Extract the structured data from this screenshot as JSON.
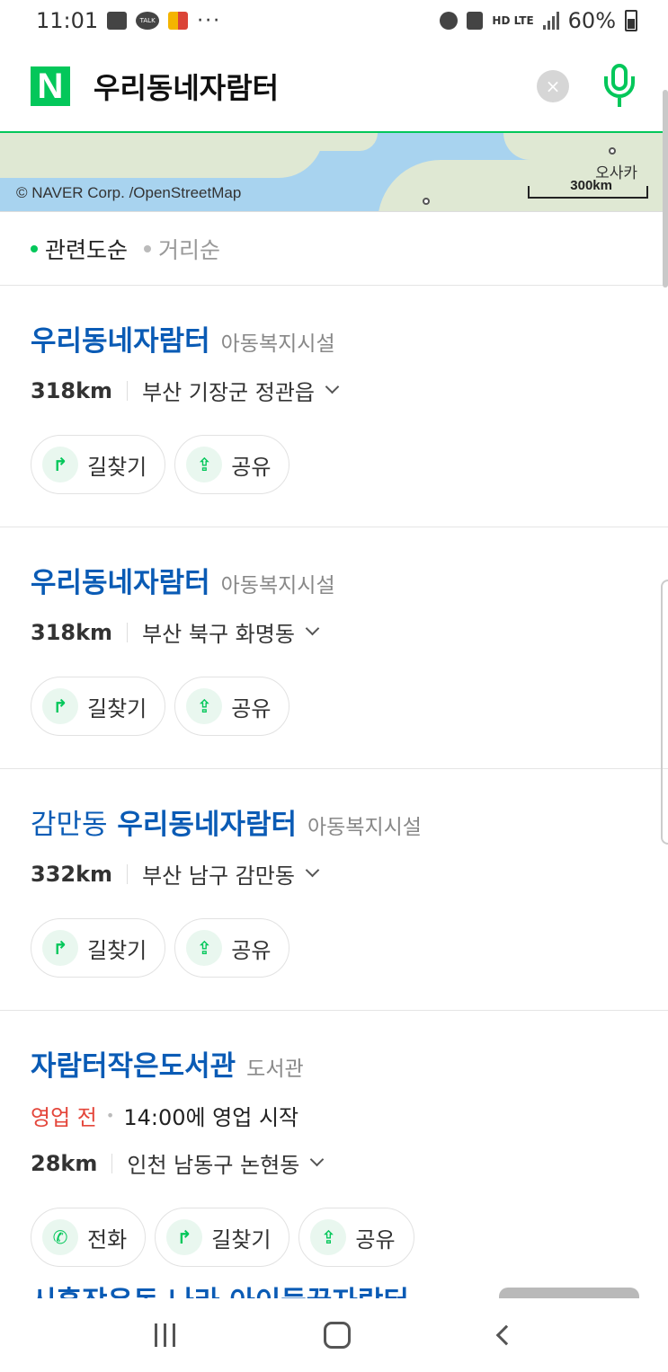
{
  "status_bar": {
    "time": "11:01",
    "talk_label": "TALK",
    "dots": "···",
    "net": "HD LTE",
    "battery": "60%"
  },
  "search": {
    "logo": "N",
    "query": "우리동네자람터",
    "clear_icon": "×"
  },
  "map": {
    "credit": "© NAVER Corp. /OpenStreetMap",
    "city": "오사카",
    "scale": "300km"
  },
  "sort": {
    "active": "관련도순",
    "inactive": "거리순"
  },
  "results": [
    {
      "title": "우리동네자람터",
      "category": "아동복지시설",
      "distance": "318km",
      "address": "부산 기장군 정관읍",
      "actions": [
        "길찾기",
        "공유"
      ]
    },
    {
      "title": "우리동네자람터",
      "category": "아동복지시설",
      "distance": "318km",
      "address": "부산 북구 화명동",
      "actions": [
        "길찾기",
        "공유"
      ]
    },
    {
      "title_prefix": "감만동",
      "title": "우리동네자람터",
      "category": "아동복지시설",
      "distance": "332km",
      "address": "부산 남구 감만동",
      "actions": [
        "길찾기",
        "공유"
      ]
    },
    {
      "title": "자람터작은도서관",
      "category": "도서관",
      "status": "영업 전",
      "hours": "14:00에 영업 시작",
      "distance": "28km",
      "address": "인천 남동구 논현동",
      "actions": [
        "전화",
        "길찾기",
        "공유"
      ]
    }
  ],
  "partial_title": "시흥장은동 나라 아이들꿈자람터"
}
